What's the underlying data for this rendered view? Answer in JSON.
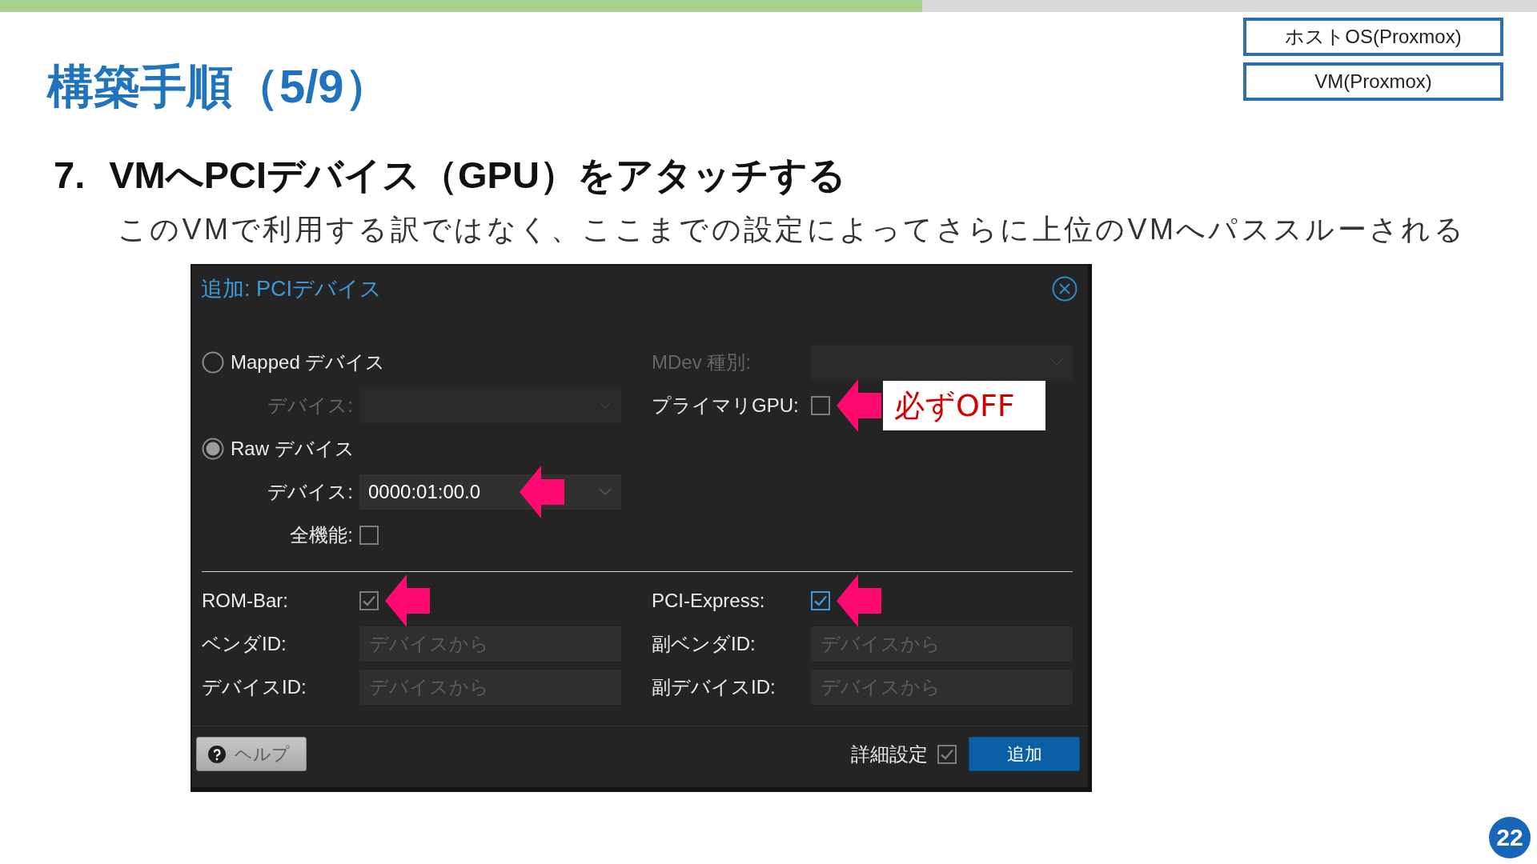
{
  "progress_bar": {
    "level": 0.6
  },
  "title": "構築手順（5/9）",
  "environment_tags": [
    "ホストOS(Proxmox)",
    "VM(Proxmox)"
  ],
  "step": {
    "number": "7.",
    "heading": "VMへPCIデバイス（GPU）をアタッチする",
    "note": "このVMで利用する訳ではなく、ここまでの設定によってさらに上位のVMへパススルーされる"
  },
  "dialog": {
    "title": "追加: PCIデバイス",
    "device_sources": [
      {
        "label": "Mapped デバイス",
        "selected": false,
        "fields": [
          {
            "kind": "combo",
            "label": "デバイス:",
            "disabled": true,
            "annotated": false
          }
        ]
      },
      {
        "label": "Raw デバイス",
        "selected": true,
        "fields": [
          {
            "kind": "combo",
            "label": "デバイス:",
            "value": "0000:01:00.0",
            "disabled": false,
            "annotated": true
          },
          {
            "kind": "checkbox",
            "label": "全機能:",
            "checked": false,
            "disabled": false,
            "annotated": false
          }
        ]
      }
    ],
    "side_fields": [
      {
        "kind": "combo",
        "label": "MDev 種別:",
        "disabled": true,
        "annotated": false
      },
      {
        "kind": "checkbox",
        "label": "プライマリGPU:",
        "checked": false,
        "disabled": false,
        "annotated": true,
        "callout": "必ずOFF"
      }
    ],
    "advanced_fields": [
      {
        "kind": "checkbox",
        "label": "ROM-Bar:",
        "checked": true,
        "focused": false,
        "annotated": true
      },
      {
        "kind": "checkbox",
        "label": "PCI-Express:",
        "checked": true,
        "focused": true,
        "annotated": true
      },
      {
        "kind": "text",
        "label": "ベンダID:",
        "placeholder": "デバイスから",
        "focused": false,
        "annotated": false
      },
      {
        "kind": "text",
        "label": "副ベンダID:",
        "placeholder": "デバイスから",
        "focused": false,
        "annotated": false
      },
      {
        "kind": "text",
        "label": "デバイスID:",
        "placeholder": "デバイスから",
        "focused": false,
        "annotated": false
      },
      {
        "kind": "text",
        "label": "副デバイスID:",
        "placeholder": "デバイスから",
        "focused": false,
        "annotated": false
      }
    ],
    "footer": {
      "help_button": "ヘルプ",
      "advanced_toggle": {
        "label": "詳細設定",
        "checked": true
      },
      "add_button": "追加"
    }
  },
  "page_number": "22"
}
